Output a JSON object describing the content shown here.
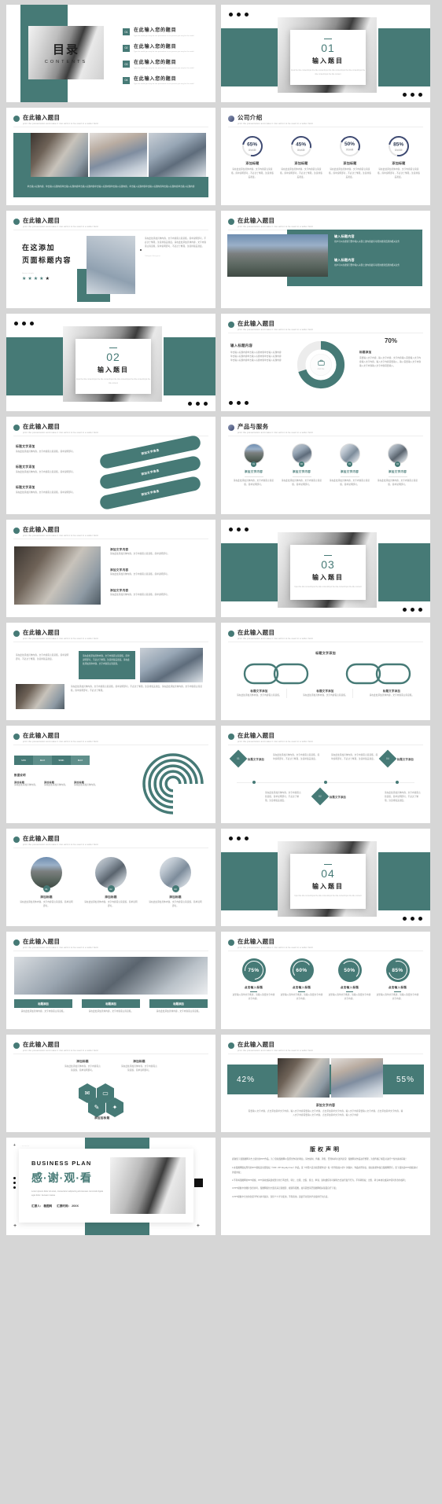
{
  "meta": {
    "accent": "#467a76",
    "accent_dark": "#2f3b54",
    "bg": "#d6d6d6"
  },
  "common": {
    "title_cn": "在此输入题目",
    "title_en": "print the presentation and make it into airtint to be used in a wider field",
    "add_title": "添加标题",
    "click_add_title": "点击输入标题",
    "add_text": "添加文字",
    "add_text2": "添加",
    "body_short": "请在此处添加具体内容，文字内容需言简意赅，简单说明即可，不必过于繁琐，注意排版美观度。",
    "body_short2": "这里输入简单文字概述，请输入简要文字内容文字内容。",
    "body_long": "单击输入标题内容单击输入标题内容单击输入标题内容单击输入标题内容"
  },
  "slides": [
    {
      "id": 1,
      "name": "contents",
      "heading_cn": "目录",
      "heading_en": "CONTENTS",
      "items": [
        {
          "no": "01",
          "label": "在此输入您的题目",
          "note": "Type the world you may be into persontion to see person you may be the world"
        },
        {
          "no": "02",
          "label": "在此输入您的题目",
          "note": "Type the world you may be into persontion to see person you may be the world"
        },
        {
          "no": "03",
          "label": "在此输入您的题目",
          "note": "Type the world you may be into persontion to see person you may be the world"
        },
        {
          "no": "04",
          "label": "在此输入您的题目",
          "note": "Type the world you may be into persontion to see person you may be the world"
        }
      ]
    },
    {
      "id": 2,
      "name": "section-cover-01",
      "number": "01",
      "title": "输入题目",
      "desc": "Input the title contentInput the title contentInput the title contentInput the title contentInput the title contentInput the title content"
    },
    {
      "id": 3,
      "name": "three-photos",
      "title": "在此输入题目",
      "body": "单击输入标题内容，单击输入标题内容单击输入标题内容单击输入标题内容单击输入标题内容单击输入标题内容，单击输入标题内容单击输入标题内容单击输入标题内容单击输入标题内容"
    },
    {
      "id": 4,
      "name": "company-intro",
      "title": "公司介绍",
      "subtitle": "print the presentation and make it into airtint to be used in a wider field",
      "stats": [
        {
          "value": "65%",
          "unit": "添加标题",
          "label": "添加标题",
          "body": "请在此处添加具体内容，文字内容需言简意赅，简单说明即可，不必过于繁琐，注意排版美观度。"
        },
        {
          "value": "45%",
          "unit": "添加标题",
          "label": "添加标题",
          "body": "请在此处添加具体内容，文字内容需言简意赅，简单说明即可，不必过于繁琐，注意排版美观度。"
        },
        {
          "value": "50%",
          "unit": "添加标题",
          "label": "添加标题",
          "body": "请在此处添加具体内容，文字内容需言简意赅，简单说明即可，不必过于繁琐，注意排版美观度。"
        },
        {
          "value": "85%",
          "unit": "添加标题",
          "label": "添加标题",
          "body": "请在此处添加具体内容，文字内容需言简意赅，简单说明即可，不必过于繁琐，注意排版美观度。"
        }
      ]
    },
    {
      "id": 5,
      "name": "page-title-stars",
      "title": "在此输入题目",
      "big_line1": "在这添加",
      "big_line2": "页面标题内容",
      "rating_label": "Service sample",
      "stars_filled": 4,
      "stars_total": 5,
      "side_body": "请在此处添加具体内容，文字内容需言简意赅，简单说明即可，不必过于繁琐，注意排版美观度。请在此处添加具体内容，文字内容需言简意赅，简单说明即可，不必过于繁琐，注意排版美观度。",
      "side_note": "Taihepian Exingoure"
    },
    {
      "id": 6,
      "name": "city-two-blocks",
      "title": "在此输入题目",
      "blocks": [
        {
          "heading": "输入标题内容",
          "body": "用户可以在搜索引擎中输入关键上述内容最有可能的搜索结果的相关业务"
        },
        {
          "heading": "输入标题内容",
          "body": "用户可以在搜索引擎中输入关键上述内容最有可能的搜索结果的相关业务"
        }
      ],
      "overlay_text": "用户可以在搜索引擎中输入关键上述内容最有可能搜索到结果的相关业务用户可以在搜索引擎中输入关键上述内容最有可能搜索到结果的相关业务"
    },
    {
      "id": 7,
      "name": "section-cover-02",
      "number": "02",
      "title": "输入题目",
      "desc": "Input the title contentInput the title contentInput the title contentInput the title contentInput the title content"
    },
    {
      "id": 8,
      "name": "donut-70",
      "title": "在此输入题目",
      "left_heading": "输入标题内容",
      "left_body": "单击输入标题内容单击输入标题内容单击输入标题内容\n单击输入标题内容单击输入标题内容单击输入标题内容\n单击输入标题内容单击输入标题内容单击输入标题内容",
      "donut_label": "Add title",
      "percent": "70%",
      "right_heading": "标题添加",
      "right_body": "需要输入文字内容，输入文字内容，文字内容输入需要输入文字内容输入文字内容，输入文字内容需要输入。输入需要输入文字内容输入文字内容输入文字内容需要输入。"
    },
    {
      "id": 9,
      "name": "three-ribbons",
      "title": "在此输入题目",
      "rows": [
        {
          "heading": "标题文字添加",
          "body": "请在此处添加具体内容，文字内容需言简意赅，简单说明即可。"
        },
        {
          "heading": "标题文字添加",
          "body": "请在此处添加具体内容，文字内容需言简意赅，简单说明即可。"
        },
        {
          "heading": "标题文字添加",
          "body": "请在此处添加具体内容，文字内容需言简意赅，简单说明即可。"
        }
      ],
      "ribbons": [
        "添加文字信息",
        "添加文字信息",
        "添加文字信息"
      ]
    },
    {
      "id": 10,
      "name": "product-services",
      "title": "产品与服务",
      "subtitle": "print the presentation and make it into airtint to be used in a wider field",
      "items": [
        {
          "no": "01",
          "label": "添加文字内容",
          "body": "请在此处添加具体内容，文字内容需言简意赅，简单说明即可。"
        },
        {
          "no": "02",
          "label": "添加文字内容",
          "body": "请在此处添加具体内容，文字内容需言简意赅，简单说明即可。"
        },
        {
          "no": "03",
          "label": "添加文字内容",
          "body": "请在此处添加具体内容，文字内容需言简意赅，简单说明即可。"
        },
        {
          "no": "04",
          "label": "添加文字内容",
          "body": "请在此处添加具体内容，文字内容需言简意赅，简单说明即可。"
        }
      ]
    },
    {
      "id": 11,
      "name": "photo-list",
      "title": "在此输入题目",
      "rows": [
        {
          "heading": "添加文字内容",
          "body": "请在此处添加具体内容，文字内容需言简意赅，简单说明即可。"
        },
        {
          "heading": "添加文字内容",
          "body": "请在此处添加具体内容，文字内容需言简意赅，简单说明即可。"
        },
        {
          "heading": "添加文字内容",
          "body": "请在此处添加具体内容，文字内容需言简意赅，简单说明即可。"
        }
      ]
    },
    {
      "id": 12,
      "name": "section-cover-03",
      "number": "03",
      "title": "输入题目",
      "desc": "Input the title contentInput the title contentInput the title contentInput the title content"
    },
    {
      "id": 13,
      "name": "photo-text-columns",
      "title": "在此输入题目",
      "left_body": "请在此处添加具体内容，文字内容需言简意赅，简单说明即可，不必过于繁琐，注意排版美观度。",
      "right_body": "请在此处添加具体内容，文字内容需言简意赅，简单说明即可，不必过于繁琐，注意排版美观度。请在此处添加具体内容，文字内容需言简意赅。",
      "bottom_body": "请在此处添加具体内容，文字内容需言简意赅，简单说明即可，不必过于繁琐，注意排版美观度。请在此处添加具体内容，文字内容需言简意赅，简单说明即可，不必过于繁琐。"
    },
    {
      "id": 14,
      "name": "chain-links",
      "title": "在此输入题目",
      "center_heading": "标题文字添加",
      "cards": [
        {
          "heading": "标题文字添加",
          "body": "请在此处添加具体内容，文字内容需言简意赅。"
        },
        {
          "heading": "标题文字添加",
          "body": "请在此处添加具体内容，文字内容需言简意赅。"
        },
        {
          "heading": "标题文字添加",
          "body": "请在此处添加具体内容，文字内容需言简意赅。"
        }
      ]
    },
    {
      "id": 15,
      "name": "spiral-chart",
      "title": "在此输入题目",
      "tabs": [
        "MIN",
        "MAX",
        "999K",
        "MAX"
      ],
      "legend_heading": "数据说明",
      "legend": [
        {
          "label": "添加标题",
          "body": "请在此处添加具体内容。"
        },
        {
          "label": "添加标题",
          "body": "请在此处添加具体内容。"
        },
        {
          "label": "添加标题",
          "body": "请在此处添加具体内容。"
        }
      ]
    },
    {
      "id": 16,
      "name": "diamond-timeline",
      "title": "在此输入题目",
      "nodes": [
        {
          "no": "01",
          "label": "标题文字添加",
          "body": "请在此处添加具体内容，文字内容需言简意赅，简单说明即可，不必过于繁琐，注意排版美观度。"
        },
        {
          "no": "02",
          "label": "标题文字添加",
          "body": "请在此处添加具体内容，文字内容需言简意赅，简单说明即可，不必过于繁琐，注意排版美观度。"
        },
        {
          "no": "03",
          "label": "标题文字添加",
          "body": "请在此处添加具体内容，文字内容需言简意赅，简单说明即可，不必过于繁琐，注意排版美观度。"
        },
        {
          "no": "04",
          "label": "标题文字添加",
          "body": "请在此处添加具体内容，文字内容需言简意赅，简单说明即可，不必过于繁琐，注意排版美观度。"
        }
      ]
    },
    {
      "id": 17,
      "name": "three-circle-photos",
      "title": "在此输入题目",
      "items": [
        {
          "no": "01",
          "label": "添加标题",
          "body": "请在此处添加具体内容，文字内容需言简意赅，简单说明即可。"
        },
        {
          "no": "02",
          "label": "添加标题",
          "body": "请在此处添加具体内容，文字内容需言简意赅，简单说明即可。"
        },
        {
          "no": "03",
          "label": "添加标题",
          "body": "请在此处添加具体内容，文字内容需言简意赅，简单说明即可。"
        }
      ]
    },
    {
      "id": 18,
      "name": "section-cover-04",
      "number": "04",
      "title": "输入题目",
      "desc": "Input the title contentInput the title contentInput the title contentInput the title content"
    },
    {
      "id": 19,
      "name": "laptop-three-tags",
      "title": "在此输入题目",
      "tags": [
        "标题添加",
        "标题添加",
        "标题添加"
      ],
      "bodies": [
        "请在此处添加具体内容，文字内容需言简意赅。",
        "请在此处添加具体内容，文字内容需言简意赅。",
        "请在此处添加具体内容，文字内容需言简意赅。"
      ]
    },
    {
      "id": 20,
      "name": "teal-percent-circles",
      "title": "在此输入题目",
      "stats": [
        {
          "value": "75%",
          "label": "点击输入标题",
          "body": "这里输入简单文字概述，请输入简要文字内容文字内容。"
        },
        {
          "value": "60%",
          "label": "点击输入标题",
          "body": "这里输入简单文字概述，请输入简要文字内容文字内容。"
        },
        {
          "value": "50%",
          "label": "点击输入标题",
          "body": "这里输入简单文字概述，请输入简要文字内容文字内容。"
        },
        {
          "value": "85%",
          "label": "点击输入标题",
          "body": "这里输入简单文字概述，请输入简要文字内容文字内容。"
        }
      ]
    },
    {
      "id": 21,
      "name": "hexagon-diagram",
      "title": "在此输入题目",
      "top_left": "添加标题",
      "top_right": "添加标题",
      "bottom_label": "添加加标题",
      "bodies": [
        "请在此处添加具体内容，文字内容需言简意赅，简单说明即可。",
        "请在此处添加具体内容，文字内容需言简意赅，简单说明即可。"
      ],
      "icons": [
        "chat-icon",
        "monitor-icon",
        "edit-icon",
        "lightbulb-icon"
      ]
    },
    {
      "id": 22,
      "name": "two-percent-photos",
      "title": "在此输入题目",
      "left_percent": "42%",
      "right_percent": "55%",
      "caption": "添加文字内容",
      "body": "需要输入文字内容，点击添加简单文字内容，输入文字内容需要输入文字内容，点击添加简单文字内容，输入文字内容需要输入文字内容，点击添加简单文字内容，输入文字内容需要输入文字内容，点击添加简单文字内容，输入文字内容"
    },
    {
      "id": 23,
      "name": "thank-you",
      "eyebrow": "BUSINESS PLAN",
      "title": "感·谢·观·看",
      "subtitle": "Lorem ipsum dolor sit amet, consectetur adipiscing elit.Aenean commodo ligula eget dolor. Aenean massa",
      "footer_left": "汇报人： 薇图网",
      "footer_right": "汇报时间： 20XX"
    },
    {
      "id": 24,
      "name": "copyright",
      "title": "版权声明",
      "intro": "感谢您下载薇图网平台上提供的PPT作品，为了您和薇图网以及原创作者的利益，请勿复制、传播、销售，否则将承担法律责任！薇图网对作品进行整理，为您传播了解及对进行个性的素材获取！",
      "paragraphs": [
        "1.在薇图网版权所有的PPT模板是免费版权（VRF: VIP Royalty-Free）作品，受《中国人民共和国著作法》和《世界版权公约》的保护，作品的所有权、版权和著作权归薇图网所有，您下载的是PPT模板素材的使用权；",
        "2.不得将薇图网的PPT模板、PPT素材或其组成部分用于再出售、转让、出租、出借、授让、申领、复制或任何可解除方式进行发行行为，不得转授权、出售、转让本协议或其中任何条款的权利；",
        "3.PPT模板中的图片仅供参考，薇图网提供大量高清正版摄影、视频等配图，如有需要请至薇图网相关版面自行下载；",
        "4.PPT模板中全文的创意学作为参考展示，仅供个人学习使用，不得商用，因此不对您的学业使用行为负责。"
      ]
    }
  ]
}
